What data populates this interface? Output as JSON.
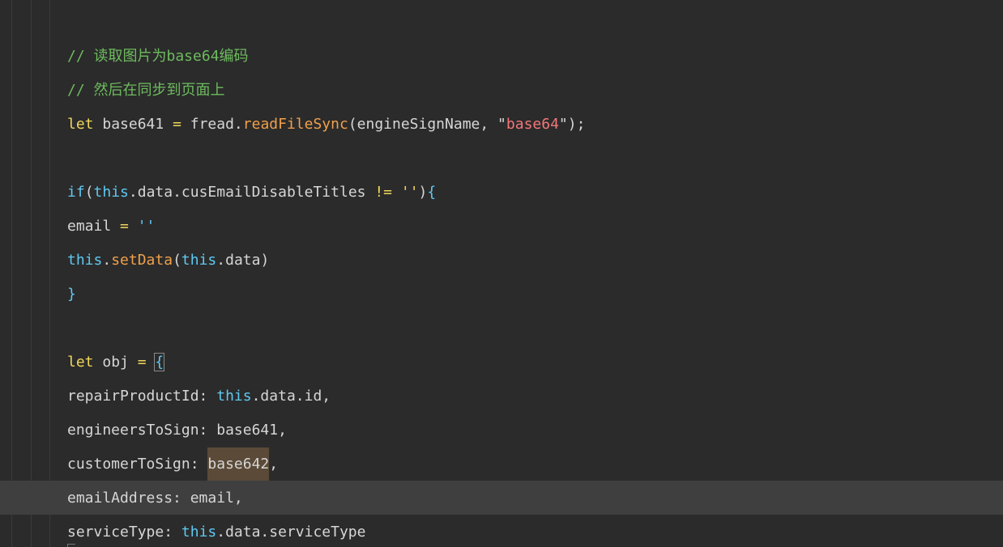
{
  "editor": {
    "lines": [
      {
        "tokens": []
      },
      {
        "tokens": [
          {
            "t": "// 读取图片为base64编码",
            "c": "c-comment"
          }
        ]
      },
      {
        "tokens": [
          {
            "t": "// 然后在同步到页面上",
            "c": "c-comment"
          }
        ]
      },
      {
        "tokens": [
          {
            "t": "let",
            "c": "c-kw"
          },
          {
            "t": " base641 ",
            "c": "c-ident"
          },
          {
            "t": "=",
            "c": "c-kw"
          },
          {
            "t": " fread.",
            "c": "c-ident"
          },
          {
            "t": "readFileSync",
            "c": "c-fn"
          },
          {
            "t": "(engineSignName, ",
            "c": "c-ident"
          },
          {
            "t": "\"",
            "c": "c-ident"
          },
          {
            "t": "base64",
            "c": "c-str"
          },
          {
            "t": "\");",
            "c": "c-ident"
          }
        ]
      },
      {
        "tokens": []
      },
      {
        "tokens": [
          {
            "t": "if",
            "c": "c-this"
          },
          {
            "t": "(",
            "c": "c-ident"
          },
          {
            "t": "this",
            "c": "c-this"
          },
          {
            "t": ".data.cusEmailDisableTitles ",
            "c": "c-ident"
          },
          {
            "t": "!=",
            "c": "c-kw"
          },
          {
            "t": " ",
            "c": "c-ident"
          },
          {
            "t": "''",
            "c": "c-str2"
          },
          {
            "t": ")",
            "c": "c-ident"
          },
          {
            "t": "{",
            "c": "c-brace"
          }
        ]
      },
      {
        "tokens": [
          {
            "t": "email ",
            "c": "c-ident"
          },
          {
            "t": "=",
            "c": "c-kw"
          },
          {
            "t": " ",
            "c": "c-ident"
          },
          {
            "t": "''",
            "c": "c-this"
          }
        ]
      },
      {
        "tokens": [
          {
            "t": "this",
            "c": "c-this"
          },
          {
            "t": ".",
            "c": "c-ident"
          },
          {
            "t": "setData",
            "c": "c-fn"
          },
          {
            "t": "(",
            "c": "c-ident"
          },
          {
            "t": "this",
            "c": "c-this"
          },
          {
            "t": ".data)",
            "c": "c-ident"
          }
        ]
      },
      {
        "tokens": [
          {
            "t": "}",
            "c": "c-brace"
          }
        ]
      },
      {
        "tokens": []
      },
      {
        "tokens": [
          {
            "t": "let",
            "c": "c-kw"
          },
          {
            "t": " obj ",
            "c": "c-ident"
          },
          {
            "t": "=",
            "c": "c-kw"
          },
          {
            "t": " ",
            "c": "c-ident"
          },
          {
            "t": "{",
            "c": "c-brace",
            "match": true
          }
        ]
      },
      {
        "tokens": [
          {
            "t": "repairProductId: ",
            "c": "c-ident"
          },
          {
            "t": "this",
            "c": "c-this"
          },
          {
            "t": ".data.id,",
            "c": "c-ident"
          }
        ]
      },
      {
        "tokens": [
          {
            "t": "engineersToSign: base641,",
            "c": "c-ident"
          }
        ]
      },
      {
        "tokens": [
          {
            "t": "customerToSign: ",
            "c": "c-ident"
          },
          {
            "t": "base642",
            "c": "c-ident",
            "hl": true
          },
          {
            "t": ",",
            "c": "c-ident"
          }
        ]
      },
      {
        "tokens": [
          {
            "t": "emailAddress: email,",
            "c": "c-ident"
          }
        ],
        "current": true
      },
      {
        "tokens": [
          {
            "t": "serviceType: ",
            "c": "c-ident"
          },
          {
            "t": "this",
            "c": "c-this"
          },
          {
            "t": ".data.serviceType",
            "c": "c-ident"
          }
        ]
      }
    ]
  }
}
